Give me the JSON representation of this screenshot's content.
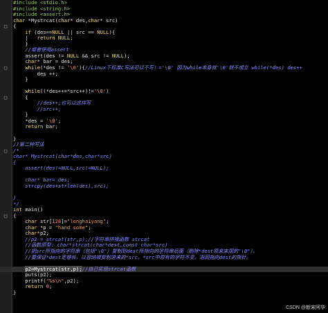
{
  "editor": {
    "lines": [
      {
        "fold": "",
        "segments": [
          [
            "pp",
            "#include <stdio.h>"
          ]
        ]
      },
      {
        "fold": "",
        "segments": [
          [
            "pp",
            "#include <string.h>"
          ]
        ]
      },
      {
        "fold": "",
        "segments": [
          [
            "pp",
            "#include <assert.h>"
          ]
        ]
      },
      {
        "fold": "",
        "segments": [
          [
            "type",
            "char"
          ],
          [
            "tx",
            " *Mystrcat("
          ],
          [
            "type",
            "char"
          ],
          [
            "tx",
            "* des,"
          ],
          [
            "type",
            "char"
          ],
          [
            "tx",
            "* src)"
          ]
        ]
      },
      {
        "fold": "□",
        "segments": [
          [
            "tx",
            "{"
          ]
        ]
      },
      {
        "fold": "",
        "segments": [
          [
            "tx",
            "    "
          ],
          [
            "kw",
            "if"
          ],
          [
            "tx",
            " (des=="
          ],
          [
            "kw",
            "NULL"
          ],
          [
            "tx",
            " || src == "
          ],
          [
            "kw",
            "NULL"
          ],
          [
            "tx",
            "){"
          ]
        ]
      },
      {
        "fold": "",
        "segments": [
          [
            "tx",
            "    |   "
          ],
          [
            "kw",
            "return"
          ],
          [
            "tx",
            " "
          ],
          [
            "kw",
            "NULL"
          ],
          [
            "tx",
            ";"
          ]
        ]
      },
      {
        "fold": "",
        "segments": [
          [
            "tx",
            "    }"
          ]
        ]
      },
      {
        "fold": "",
        "segments": [
          [
            "cm",
            "    //或者使用assert"
          ]
        ]
      },
      {
        "fold": "",
        "segments": [
          [
            "tx",
            "    assert(des != "
          ],
          [
            "kw",
            "NULL"
          ],
          [
            "tx",
            " && src != "
          ],
          [
            "kw",
            "NULL"
          ],
          [
            "tx",
            ");"
          ]
        ]
      },
      {
        "fold": "",
        "segments": [
          [
            "tx",
            "    "
          ],
          [
            "type",
            "char"
          ],
          [
            "tx",
            "* bar = des;"
          ]
        ]
      },
      {
        "fold": "□",
        "segments": [
          [
            "tx",
            "    "
          ],
          [
            "kw",
            "while"
          ],
          [
            "tx",
            "(*des != "
          ],
          [
            "str",
            "'\\0'"
          ],
          [
            "tx",
            "){"
          ],
          [
            "cm",
            "//Linux下标准C写法可以不写！='\\0' 因为while本身就'\\0'就不成立 while(*des) des++"
          ]
        ]
      },
      {
        "fold": "",
        "segments": [
          [
            "tx",
            "        des ++;"
          ]
        ]
      },
      {
        "fold": "",
        "segments": [
          [
            "tx",
            "    }"
          ]
        ]
      },
      {
        "fold": "",
        "segments": [
          [
            "tx",
            ""
          ]
        ]
      },
      {
        "fold": "",
        "segments": [
          [
            "tx",
            "    "
          ],
          [
            "kw",
            "while"
          ],
          [
            "tx",
            "((*des++=*src++)!="
          ],
          [
            "str",
            "'\\0'"
          ],
          [
            "tx",
            ")"
          ]
        ]
      },
      {
        "fold": "□",
        "segments": [
          [
            "tx",
            "    {"
          ]
        ]
      },
      {
        "fold": "",
        "segments": [
          [
            "cm",
            "        //des++;也可以这样写"
          ]
        ]
      },
      {
        "fold": "",
        "segments": [
          [
            "cm",
            "        //src++;"
          ]
        ]
      },
      {
        "fold": "",
        "segments": [
          [
            "tx",
            "    }"
          ]
        ]
      },
      {
        "fold": "",
        "segments": [
          [
            "tx",
            "    *des = "
          ],
          [
            "str",
            "'\\0'"
          ],
          [
            "tx",
            ";"
          ]
        ]
      },
      {
        "fold": "",
        "segments": [
          [
            "tx",
            "    "
          ],
          [
            "kw",
            "return"
          ],
          [
            "tx",
            " bar;"
          ]
        ]
      },
      {
        "fold": "",
        "segments": [
          [
            "tx",
            ""
          ]
        ]
      },
      {
        "fold": "",
        "segments": [
          [
            "tx",
            "}"
          ]
        ]
      },
      {
        "fold": "",
        "segments": [
          [
            "cm",
            "//第二种写法"
          ]
        ]
      },
      {
        "fold": "□",
        "segments": [
          [
            "cm",
            "/*"
          ]
        ]
      },
      {
        "fold": "",
        "segments": [
          [
            "cm",
            "char* Mystrcat(char*des,char*src)"
          ]
        ]
      },
      {
        "fold": "",
        "segments": [
          [
            "cm",
            "{"
          ]
        ]
      },
      {
        "fold": "",
        "segments": [
          [
            "cm",
            "    assert(des!=NULL,src!=NULL);"
          ]
        ]
      },
      {
        "fold": "",
        "segments": [
          [
            "cm",
            ""
          ]
        ]
      },
      {
        "fold": "",
        "segments": [
          [
            "cm",
            "    char* bar= des;"
          ]
        ]
      },
      {
        "fold": "",
        "segments": [
          [
            "cm",
            "    strcpy(des+strlen(des),src);"
          ]
        ]
      },
      {
        "fold": "",
        "segments": [
          [
            "cm",
            ""
          ]
        ]
      },
      {
        "fold": "",
        "segments": [
          [
            "cm",
            "}"
          ]
        ]
      },
      {
        "fold": "",
        "segments": [
          [
            "cm",
            "*/"
          ]
        ]
      },
      {
        "fold": "",
        "segments": [
          [
            "kw",
            "int"
          ],
          [
            "tx",
            " main()"
          ]
        ]
      },
      {
        "fold": "□",
        "segments": [
          [
            "tx",
            "{"
          ]
        ]
      },
      {
        "fold": "",
        "segments": [
          [
            "tx",
            "    "
          ],
          [
            "type",
            "char"
          ],
          [
            "tx",
            " str["
          ],
          [
            "num",
            "128"
          ],
          [
            "tx",
            "]="
          ],
          [
            "str",
            "\"longhaiyang\""
          ],
          [
            "tx",
            ";"
          ]
        ]
      },
      {
        "fold": "",
        "segments": [
          [
            "tx",
            "    "
          ],
          [
            "type",
            "char"
          ],
          [
            "tx",
            " *p = "
          ],
          [
            "str",
            "\"hand some\""
          ],
          [
            "tx",
            ";"
          ]
        ]
      },
      {
        "fold": "",
        "segments": [
          [
            "tx",
            "    "
          ],
          [
            "type",
            "char"
          ],
          [
            "tx",
            "*p2;"
          ]
        ]
      },
      {
        "fold": "",
        "segments": [
          [
            "cm",
            "    //p2 = strcat(str,p);//字符串拼接函数 strcat"
          ]
        ]
      },
      {
        "fold": "",
        "segments": [
          [
            "cm",
            "    //函数原型: char*strcat(char*dest,const char*src)"
          ]
        ]
      },
      {
        "fold": "",
        "segments": [
          [
            "cm",
            "    //把src所指向的字符串（包括\"\\0\"）复制到dest所指向的字符串后面（删除*dest原来末尾的\"\\0\"）。"
          ]
        ]
      },
      {
        "fold": "",
        "segments": [
          [
            "cm",
            "    //要保证*dest足够长，以容纳被复制进来的*src。*src中原有的字符不变。返回指向dest的指针。"
          ]
        ]
      },
      {
        "fold": "",
        "segments": [
          [
            "tx",
            ""
          ]
        ]
      },
      {
        "fold": "",
        "current": true,
        "segments": [
          [
            "tx",
            "    "
          ],
          [
            "hl",
            "p2=Mystrcat(str,p);"
          ],
          [
            "cm",
            "//自己实现strcat函数"
          ]
        ]
      },
      {
        "fold": "",
        "segments": [
          [
            "tx",
            "    puts(p2);"
          ]
        ]
      },
      {
        "fold": "",
        "segments": [
          [
            "tx",
            "    printf("
          ],
          [
            "str",
            "\"%s\\n\""
          ],
          [
            "tx",
            ",p2);"
          ]
        ]
      },
      {
        "fold": "",
        "segments": [
          [
            "tx",
            "    "
          ],
          [
            "kw",
            "return"
          ],
          [
            "tx",
            " "
          ],
          [
            "num",
            "0"
          ],
          [
            "tx",
            ";"
          ]
        ]
      },
      {
        "fold": "",
        "segments": [
          [
            "tx",
            "}"
          ]
        ]
      },
      {
        "fold": "",
        "segments": [
          [
            "tx",
            ""
          ]
        ]
      },
      {
        "fold": "",
        "segments": [
          [
            "tx",
            ""
          ]
        ]
      }
    ]
  },
  "watermark": "CSDN @新宋阿华"
}
